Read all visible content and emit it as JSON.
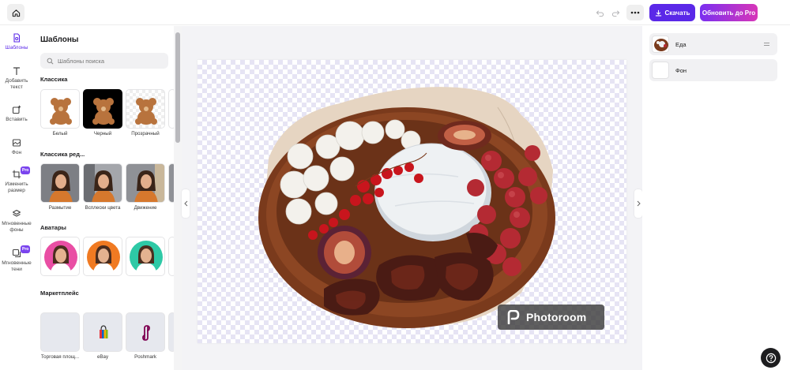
{
  "topbar": {
    "download_label": "Скачать",
    "upgrade_label": "Обновить до Pro"
  },
  "rail": {
    "items": [
      {
        "label": "Шаблоны",
        "icon": "template-icon",
        "active": true
      },
      {
        "label": "Добавить текст",
        "icon": "text-icon"
      },
      {
        "label": "Вставить",
        "icon": "insert-icon"
      },
      {
        "label": "Фон",
        "icon": "background-icon"
      },
      {
        "label": "Изменить размер",
        "icon": "resize-icon",
        "pro": "Pro"
      },
      {
        "label": "Мгновенные фоны",
        "icon": "instant-backgrounds-icon"
      },
      {
        "label": "Мгновенные тени",
        "icon": "instant-shadows-icon",
        "pro": "Pro"
      }
    ]
  },
  "panel": {
    "title": "Шаблоны",
    "search_placeholder": "Шаблоны поиска",
    "sections": [
      {
        "title": "Классика",
        "items": [
          "Белый",
          "Черный",
          "Прозрачный"
        ]
      },
      {
        "title": "Классика ред...",
        "items": [
          "Размытие",
          "Всплески цвета",
          "Движение"
        ]
      },
      {
        "title": "Аватары",
        "items": []
      },
      {
        "title": "Маркетплейс",
        "items": [
          "Торговая площ...",
          "eBay",
          "Poshmark"
        ]
      }
    ]
  },
  "canvas": {
    "watermark": "Photoroom"
  },
  "layers": {
    "items": [
      {
        "name": "Еда"
      },
      {
        "name": "Фон"
      }
    ]
  },
  "colors": {
    "accent": "#5a28e8",
    "pro_gradient_start": "#7a2ff0",
    "pro_gradient_end": "#d736b8"
  }
}
